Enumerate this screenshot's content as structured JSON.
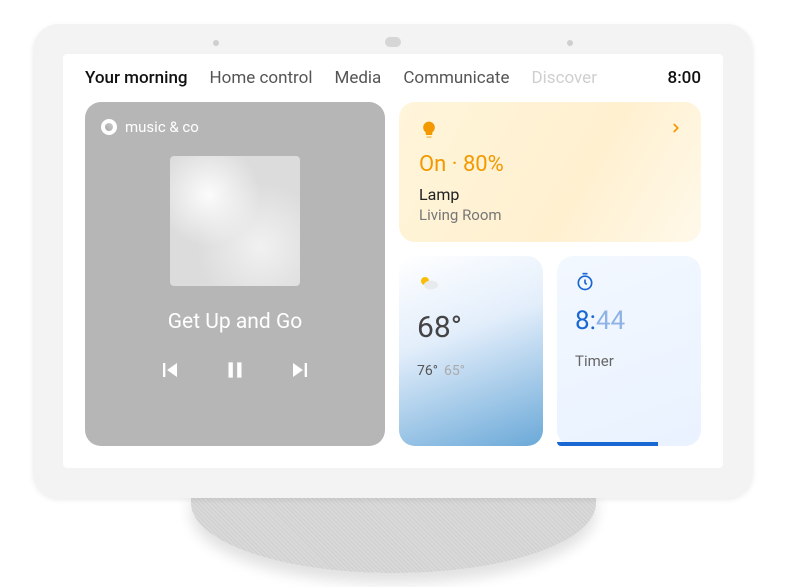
{
  "tabs": {
    "t0": "Your morning",
    "t1": "Home control",
    "t2": "Media",
    "t3": "Communicate",
    "t4": "Discover"
  },
  "clock": "8:00",
  "music": {
    "source": "music & co",
    "track": "Get Up and Go"
  },
  "light": {
    "status": "On · 80%",
    "name": "Lamp",
    "room": "Living Room"
  },
  "weather": {
    "temp": "68°",
    "high": "76°",
    "low": "65°"
  },
  "timer": {
    "time_strong": "8:",
    "time_dim": "44",
    "label": "Timer",
    "progress_pct": 70
  },
  "colors": {
    "accent_orange": "#f29900",
    "accent_blue": "#1967d2"
  }
}
